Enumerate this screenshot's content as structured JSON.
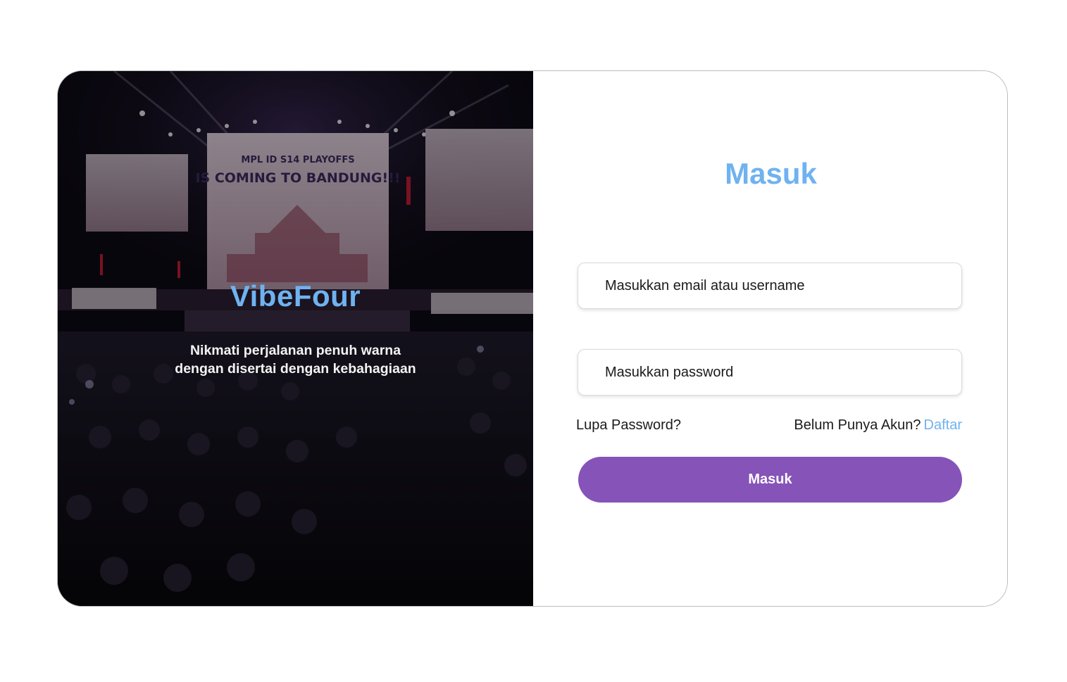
{
  "hero": {
    "title": "VibeFour",
    "tagline_line1": "Nikmati perjalanan penuh warna",
    "tagline_line2": "dengan disertai dengan kebahagiaan",
    "screen_text_line1": "MPL ID S14 PLAYOFFS",
    "screen_text_line2": "IS COMING TO BANDUNG!!!"
  },
  "form": {
    "title": "Masuk",
    "email_placeholder": "Masukkan email atau username",
    "password_placeholder": "Masukkan password",
    "forgot_label": "Lupa Password?",
    "no_account_label": "Belum Punya Akun?",
    "signup_label": "Daftar",
    "submit_label": "Masuk"
  },
  "colors": {
    "accent_blue": "#6fb2f0",
    "button_purple": "#8653b8"
  }
}
